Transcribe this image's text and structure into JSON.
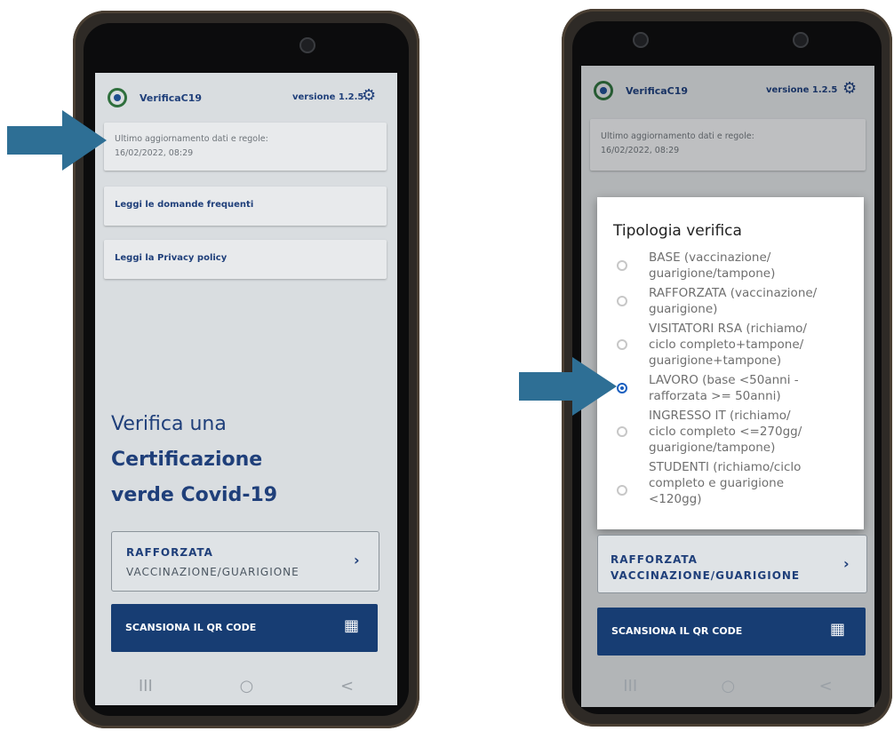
{
  "left": {
    "app_title": "VerificaC19",
    "version": "versione 1.2.5",
    "gear_icon": "gear-icon",
    "update_card": {
      "line1": "Ultimo aggiornamento dati e regole:",
      "line2": "16/02/2022, 08:29"
    },
    "faq_label": "Leggi le domande frequenti",
    "privacy_label": "Leggi la Privacy policy",
    "headline": {
      "line1": "Verifica una",
      "line2": "Certificazione",
      "line3": "verde Covid-19"
    },
    "mode": {
      "line1": "RAFFORZATA",
      "line2": "VACCINAZIONE/GUARIGIONE"
    },
    "scan_label": "SCANSIONA IL QR CODE",
    "nav": {
      "recents": "III",
      "home": "○",
      "back": "<"
    }
  },
  "right": {
    "app_title": "VerificaC19",
    "version": "versione 1.2.5",
    "update_card": {
      "line1": "Ultimo aggiornamento dati e regole:",
      "line2": "16/02/2022, 08:29"
    },
    "dialog": {
      "title": "Tipologia verifica",
      "options": [
        {
          "line1": "BASE (vaccinazione/",
          "line2": "guarigione/tampone)",
          "line3": "",
          "selected": false
        },
        {
          "line1": "RAFFORZATA (vaccinazione/",
          "line2": "guarigione)",
          "line3": "",
          "selected": false
        },
        {
          "line1": "VISITATORI RSA (richiamo/",
          "line2": "ciclo completo+tampone/",
          "line3": "guarigione+tampone)",
          "selected": false
        },
        {
          "line1": "LAVORO (base <50anni -",
          "line2": "rafforzata >= 50anni)",
          "line3": "",
          "selected": true
        },
        {
          "line1": "INGRESSO IT (richiamo/",
          "line2": "ciclo completo <=270gg/",
          "line3": "guarigione/tampone)",
          "selected": false
        },
        {
          "line1": "STUDENTI (richiamo/ciclo",
          "line2": "completo e guarigione",
          "line3": "<120gg)",
          "selected": false
        }
      ]
    },
    "mode": {
      "line1": "RAFFORZATA",
      "line2": "VACCINAZIONE/GUARIGIONE"
    },
    "scan_label": "SCANSIONA IL QR CODE",
    "nav": {
      "recents": "III",
      "home": "○",
      "back": "<"
    }
  },
  "colors": {
    "primary": "#173d73",
    "arrow": "#2e6f95",
    "radio_selected": "#1a5fbf"
  }
}
